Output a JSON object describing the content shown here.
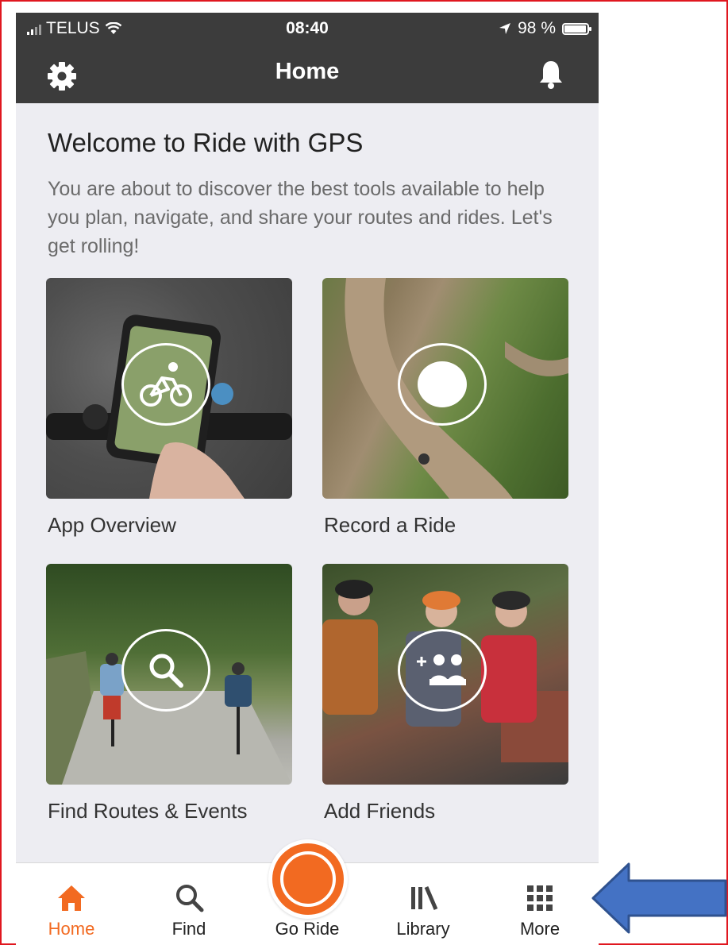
{
  "status_bar": {
    "carrier": "TELUS",
    "time": "08:40",
    "battery": "98 %"
  },
  "header": {
    "title": "Home"
  },
  "welcome": {
    "title": "Welcome to Ride with GPS",
    "body": "You are about to discover the best tools available to help you plan, navigate, and share your routes and rides. Let's get rolling!"
  },
  "tiles": [
    {
      "label": "App Overview",
      "icon": "cyclist-icon"
    },
    {
      "label": "Record a Ride",
      "icon": "record-dot-icon"
    },
    {
      "label": "Find Routes & Events",
      "icon": "search-icon"
    },
    {
      "label": "Add Friends",
      "icon": "add-friends-icon"
    }
  ],
  "tabbar": {
    "items": [
      {
        "label": "Home",
        "icon": "home-icon",
        "active": true
      },
      {
        "label": "Find",
        "icon": "search-icon"
      },
      {
        "label": "Go Ride",
        "icon": "record-button-icon"
      },
      {
        "label": "Library",
        "icon": "library-icon"
      },
      {
        "label": "More",
        "icon": "grid-icon"
      }
    ]
  },
  "colors": {
    "accent": "#f26a21",
    "header_bg": "#3c3c3c",
    "page_bg": "#ededf2",
    "annotation_arrow": "#4472c4",
    "frame_border": "#e0171f"
  }
}
